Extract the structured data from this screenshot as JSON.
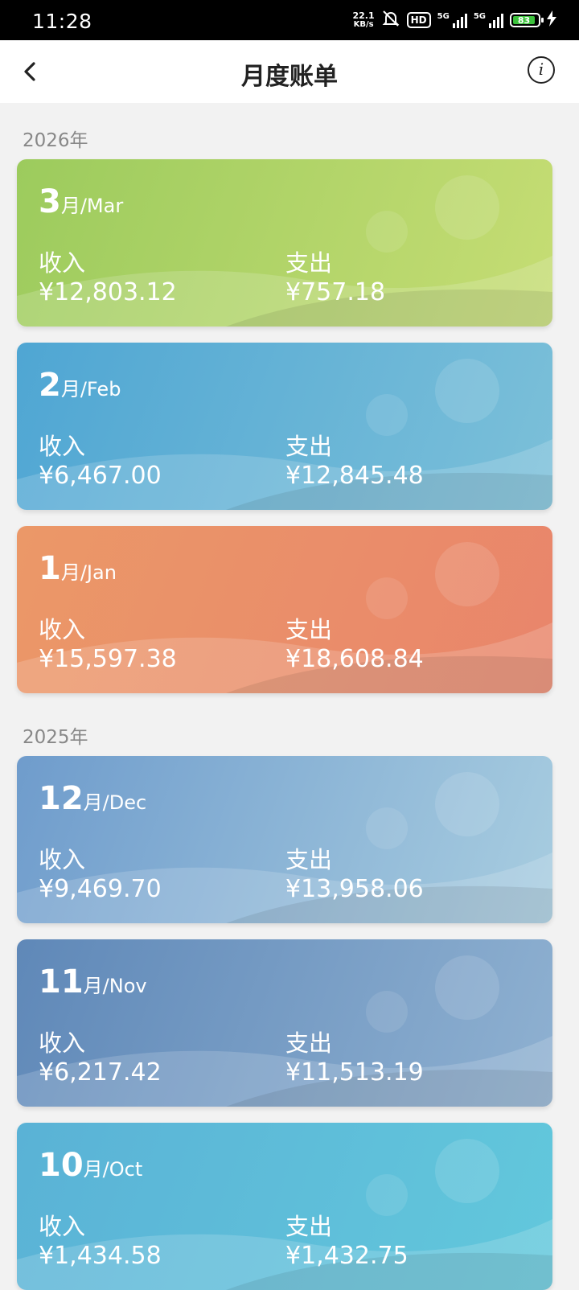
{
  "status_bar": {
    "time": "11:28",
    "net_speed": "22.1",
    "net_unit": "KB/s",
    "hd": "HD",
    "sig1": "5G",
    "sig2": "5G",
    "battery": "83"
  },
  "header": {
    "title": "月度账单"
  },
  "labels": {
    "income": "收入",
    "expense": "支出"
  },
  "years": [
    {
      "label": "2026年",
      "months": [
        {
          "num": "3",
          "zh": "月",
          "en": "/Mar",
          "income": "¥12,803.12",
          "expense": "¥757.18",
          "colors": [
            "#9ccb5d",
            "#c6dd74"
          ]
        },
        {
          "num": "2",
          "zh": "月",
          "en": "/Feb",
          "income": "¥6,467.00",
          "expense": "¥12,845.48",
          "colors": [
            "#4fa6d3",
            "#7cc0d9"
          ]
        },
        {
          "num": "1",
          "zh": "月",
          "en": "/Jan",
          "income": "¥15,597.38",
          "expense": "¥18,608.84",
          "colors": [
            "#eb9868",
            "#e9856b"
          ]
        }
      ]
    },
    {
      "label": "2025年",
      "months": [
        {
          "num": "12",
          "zh": "月",
          "en": "/Dec",
          "income": "¥9,469.70",
          "expense": "¥13,958.06",
          "colors": [
            "#6f9ccc",
            "#a8cde0"
          ]
        },
        {
          "num": "11",
          "zh": "月",
          "en": "/Nov",
          "income": "¥6,217.42",
          "expense": "¥11,513.19",
          "colors": [
            "#5f88b8",
            "#8fb1d1"
          ]
        },
        {
          "num": "10",
          "zh": "月",
          "en": "/Oct",
          "income": "¥1,434.58",
          "expense": "¥1,432.75",
          "colors": [
            "#5ab2d6",
            "#62c8dc"
          ]
        }
      ]
    }
  ]
}
